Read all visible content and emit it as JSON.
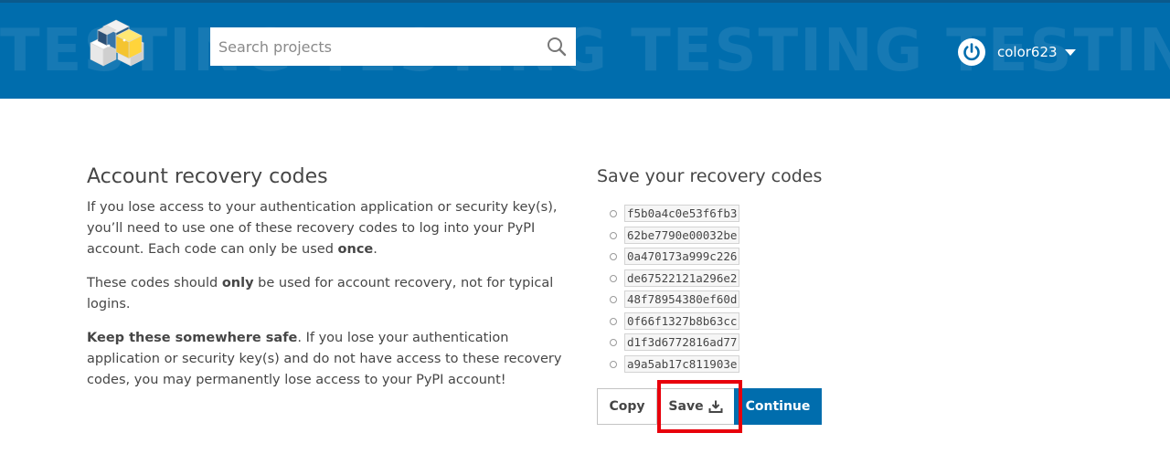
{
  "header": {
    "banner_word": "TESTING",
    "search": {
      "placeholder": "Search projects"
    },
    "user": {
      "username": "color623"
    }
  },
  "left": {
    "title": "Account recovery codes",
    "para1_part1": "If you lose access to your authentication application or security key(s), you’ll need to use one of these recovery codes to log into your PyPI account. Each code can only be used ",
    "para1_bold": "once",
    "para1_part2": ".",
    "para2_part1": "These codes should ",
    "para2_bold": "only",
    "para2_part2": " be used for account recovery, not for typical logins.",
    "para3_bold": "Keep these somewhere safe",
    "para3_part2": ". If you lose your authentication application or security key(s) and do not have access to these recovery codes, you may permanently lose access to your PyPI account!"
  },
  "right": {
    "title": "Save your recovery codes",
    "codes": [
      "f5b0a4c0e53f6fb3",
      "62be7790e00032be",
      "0a470173a999c226",
      "de67522121a296e2",
      "48f78954380ef60d",
      "0f66f1327b8b63cc",
      "d1f3d6772816ad77",
      "a9a5ab17c811903e"
    ]
  },
  "buttons": {
    "copy_label": "Copy",
    "save_label": "Save",
    "continue_label": "Continue"
  },
  "colors": {
    "header_bg": "#006dad",
    "primary_button": "#006dad",
    "highlight": "#e8000b"
  },
  "icons": {
    "logo": "pypi-logo-icon",
    "search": "search-icon",
    "user": "power-icon",
    "menu": "caret-down-icon",
    "save": "download-icon"
  }
}
